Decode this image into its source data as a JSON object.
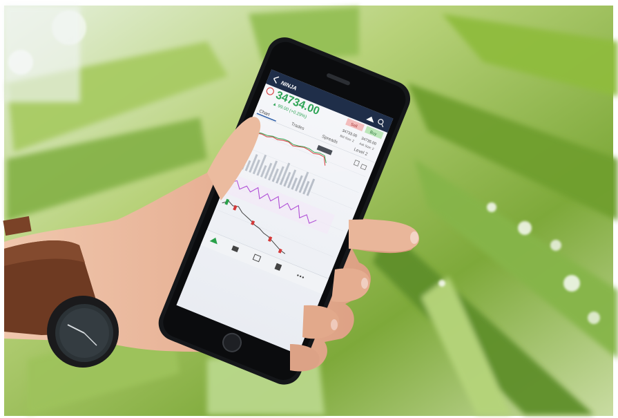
{
  "quote": {
    "price": "34734.00",
    "change": "▲ 99.00 (+0.29%)"
  },
  "trade": {
    "sell_label": "Sell",
    "buy_label": "Buy",
    "bid_price": "34733.00",
    "ask_price": "34735.00",
    "bid_size": "Bid Size: 2",
    "ask_size": "Ask Size: 2"
  },
  "tabs": {
    "chart": "Chart",
    "trades": "Trades",
    "spreads": "Spreads",
    "level2": "Level 2"
  },
  "colors": {
    "price_up": "#1e9e49",
    "sell": "#f2b8b8",
    "buy": "#b7e4b4",
    "rsi_line": "#b04fd6",
    "candle_up": "#2aa14a",
    "candle_down": "#d43a3a"
  },
  "icons": [
    "back-arrow-icon",
    "home-icon",
    "search-icon",
    "share-icon",
    "lock-icon",
    "alert-clock-icon"
  ],
  "bottom_nav": [
    "portfolio-icon",
    "trade-icon",
    "chart-icon",
    "calculator-icon",
    "more-icon"
  ]
}
